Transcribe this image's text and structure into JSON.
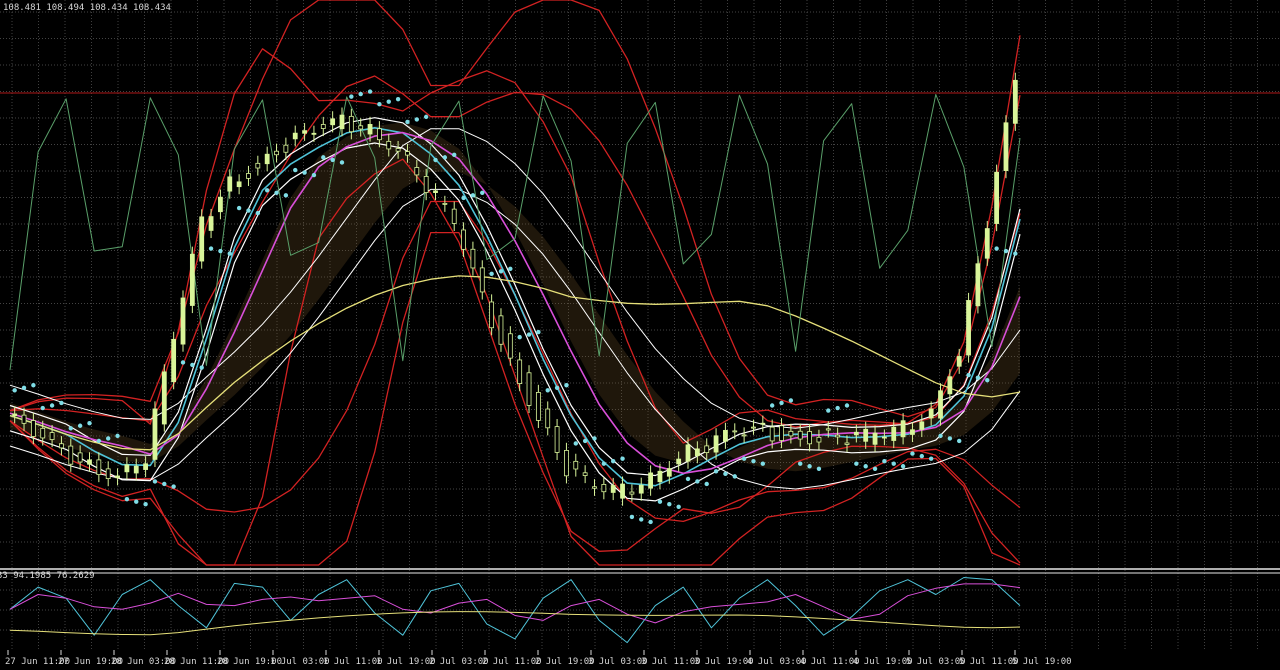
{
  "header": {
    "price_readout": "108.481 108.494 108.434 108.434"
  },
  "indicator": {
    "readout": "33 94.1985 76.2629"
  },
  "colors": {
    "background": "#000000",
    "grid": "#5a5a5a",
    "separator": "#e8e8e8",
    "candle": "#d9f59a",
    "bollinger": "#d22222",
    "envelope": "#ffffff",
    "parabolic_sar": "#7fdde6",
    "ma_cyan": "#4fc3d8",
    "ma_magenta": "#d94fd9",
    "ma_yellow": "#e6e07a",
    "oscillator_green": "#5aa06a",
    "horizontal_line": "#b01818"
  },
  "chart_data": {
    "type": "line",
    "grid": true,
    "x_tick_labels": [
      "27 Jun 11:00",
      "27 Jun 19:00",
      "28 Jun 03:00",
      "28 Jun 11:00",
      "28 Jun 19:00",
      "1 Jul 03:00",
      "1 Jul 11:00",
      "1 Jul 19:00",
      "2 Jul 03:00",
      "2 Jul 11:00",
      "2 Jul 19:00",
      "3 Jul 03:00",
      "3 Jul 11:00",
      "3 Jul 19:00",
      "4 Jul 03:00",
      "4 Jul 11:00",
      "4 Jul 19:00",
      "5 Jul 03:00",
      "5 Jul 11:00",
      "5 Jul 19:00"
    ],
    "last_price": {
      "open": 108.481,
      "high": 108.494,
      "low": 108.434,
      "close": 108.434
    },
    "ylim": [
      106.55,
      108.75
    ],
    "price_series": [
      107.14,
      107.07,
      106.99,
      106.94,
      106.91,
      106.98,
      107.45,
      107.9,
      108.06,
      108.13,
      108.21,
      108.26,
      108.3,
      108.27,
      108.2,
      108.05,
      107.9,
      107.6,
      107.35,
      107.14,
      106.93,
      106.85,
      106.84,
      106.9,
      106.99,
      107.02,
      107.07,
      107.08,
      107.05,
      107.06,
      107.05,
      107.06,
      107.09,
      107.16,
      107.4,
      107.9,
      108.45
    ],
    "indicator_ylim": [
      0,
      100
    ],
    "oscillator": [
      55,
      85,
      70,
      20,
      75,
      95,
      60,
      30,
      90,
      85,
      40,
      75,
      95,
      50,
      20,
      80,
      90,
      35,
      15,
      70,
      95,
      40,
      10,
      60,
      85,
      30,
      70,
      95,
      60,
      20,
      45,
      80,
      95,
      75,
      98,
      95,
      60
    ]
  }
}
